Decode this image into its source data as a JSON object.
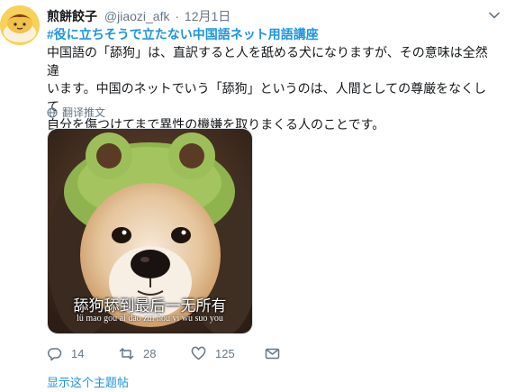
{
  "tweet": {
    "author_name": "煎餅餃子",
    "handle": "@jiaozi_afk",
    "separator": "·",
    "date": "12月1日",
    "hashtag": "#役に立ちそうで立たない中国語ネット用語講座",
    "body_line1": "中国語の「舔狗」は、直訳すると人を舐める犬になりますが、その意味は全然違",
    "body_line2": "います。中国のネットでいう「舔狗」というのは、人間としての尊厳をなくして",
    "body_line3": "自分を傷つけてまで異性の機嫌を取りまくる人のことです。",
    "translate_label": "翻译推文"
  },
  "media": {
    "caption": "舔狗舔到最后一无所有",
    "pinyin": "lü mao gou ai dao zui hou yi wu suo you"
  },
  "actions": {
    "reply_count": "14",
    "retweet_count": "28",
    "like_count": "125"
  },
  "show_thread_label": "显示这个主题帖",
  "colors": {
    "link": "#1b95e0",
    "secondary": "#657786",
    "text": "#14171a"
  },
  "icons": [
    "avatar",
    "caret-down-icon",
    "globe-icon",
    "reply-icon",
    "retweet-icon",
    "heart-icon",
    "message-icon"
  ]
}
